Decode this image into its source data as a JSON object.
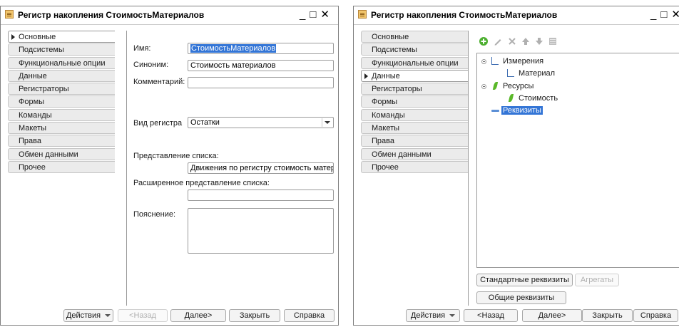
{
  "left_window": {
    "title": "Регистр накопления СтоимостьМатериалов",
    "controls": {
      "minimize": "_",
      "maximize": "□",
      "close": "✕"
    },
    "tabs": [
      {
        "label": "Основные",
        "active": true
      },
      {
        "label": "Подсистемы",
        "active": false
      },
      {
        "label": "Функциональные опции",
        "active": false
      },
      {
        "label": "Данные",
        "active": false
      },
      {
        "label": "Регистраторы",
        "active": false
      },
      {
        "label": "Формы",
        "active": false
      },
      {
        "label": "Команды",
        "active": false
      },
      {
        "label": "Макеты",
        "active": false
      },
      {
        "label": "Права",
        "active": false
      },
      {
        "label": "Обмен данными",
        "active": false
      },
      {
        "label": "Прочее",
        "active": false
      }
    ],
    "form": {
      "name_label": "Имя:",
      "name_value": "СтоимостьМатериалов",
      "synonym_label": "Синоним:",
      "synonym_value": "Стоимость материалов",
      "comment_label": "Комментарий:",
      "comment_value": "",
      "register_type_label": "Вид регистра",
      "register_type_value": "Остатки",
      "list_presentation_label": "Представление списка:",
      "list_presentation_value": "Движения по регистру стоимость матер",
      "extended_list_presentation_label": "Расширенное представление списка:",
      "extended_list_presentation_value": "",
      "explanation_label": "Пояснение:",
      "explanation_value": ""
    },
    "buttons": {
      "actions": "Действия",
      "back": "<Назад",
      "next": "Далее>",
      "close": "Закрыть",
      "help": "Справка"
    }
  },
  "right_window": {
    "title": "Регистр накопления СтоимостьМатериалов",
    "controls": {
      "minimize": "_",
      "maximize": "□",
      "close": "✕"
    },
    "tabs": [
      {
        "label": "Основные",
        "active": false
      },
      {
        "label": "Подсистемы",
        "active": false
      },
      {
        "label": "Функциональные опции",
        "active": false
      },
      {
        "label": "Данные",
        "active": true
      },
      {
        "label": "Регистраторы",
        "active": false
      },
      {
        "label": "Формы",
        "active": false
      },
      {
        "label": "Команды",
        "active": false
      },
      {
        "label": "Макеты",
        "active": false
      },
      {
        "label": "Права",
        "active": false
      },
      {
        "label": "Обмен данными",
        "active": false
      },
      {
        "label": "Прочее",
        "active": false
      }
    ],
    "toolbar_icons": [
      "add-icon",
      "edit-icon",
      "delete-icon",
      "move-up-icon",
      "move-down-icon",
      "sort-icon"
    ],
    "tree": {
      "dimensions_label": "Измерения",
      "dimension_material": "Материал",
      "resources_label": "Ресурсы",
      "resource_cost": "Стоимость",
      "attributes_label": "Реквизиты"
    },
    "buttons": {
      "standard_attributes": "Стандартные реквизиты",
      "aggregates": "Агрегаты",
      "common_attributes": "Общие реквизиты",
      "actions": "Действия",
      "back": "<Назад",
      "next": "Далее>",
      "close": "Закрыть",
      "help": "Справка"
    }
  },
  "colors": {
    "selection": "#3375d6",
    "accent_icon": "#f1c56c",
    "leaf_green": "#5ab829"
  }
}
